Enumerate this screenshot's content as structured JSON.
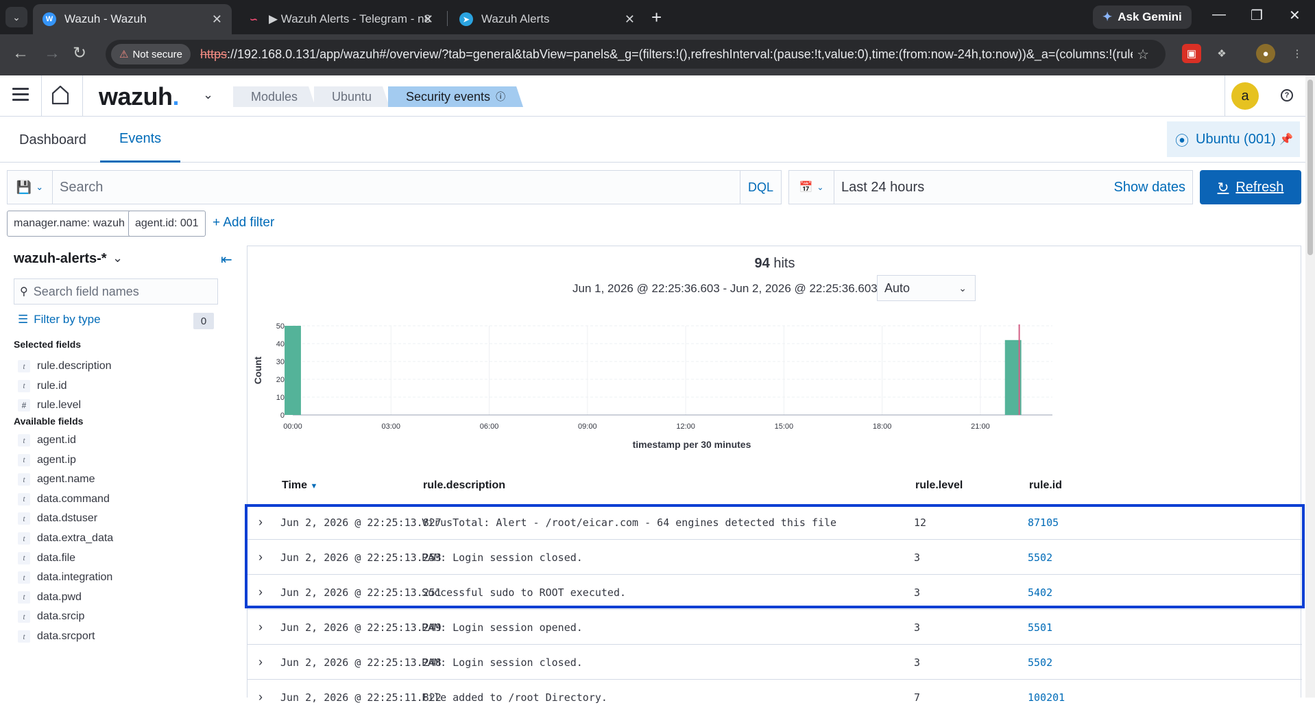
{
  "browser": {
    "tabs": [
      {
        "title": "Wazuh - Wazuh",
        "icon": "wazuh-favicon"
      },
      {
        "title": "▶ Wazuh Alerts - Telegram - n8",
        "icon": "n8n-favicon"
      },
      {
        "title": "Wazuh Alerts",
        "icon": "telegram-favicon"
      }
    ],
    "ask_gemini": "Ask Gemini",
    "not_secure": "Not secure",
    "url_scheme": "https",
    "url_rest": "://192.168.0.131/app/wazuh#/overview/?tab=general&tabView=panels&_g=(filters:!(),refreshInterval:(pause:!t,value:0),time:(from:now-24h,to:now))&_a=(columns:!(rule.d..."
  },
  "header": {
    "logo": "wazuh",
    "breadcrumbs": [
      "Modules",
      "Ubuntu",
      "Security events"
    ],
    "avatar": "a"
  },
  "page_tabs": [
    "Dashboard",
    "Events"
  ],
  "agent_pill": "Ubuntu (001)",
  "search": {
    "placeholder": "Search",
    "dql": "DQL",
    "date_range": "Last 24 hours",
    "show_dates": "Show dates",
    "refresh": "Refresh"
  },
  "filters": [
    "manager.name: wazuh",
    "agent.id: 001"
  ],
  "add_filter": "+ Add filter",
  "sidebar": {
    "index_pattern": "wazuh-alerts-*",
    "field_search_placeholder": "Search field names",
    "filter_by_type": "Filter by type",
    "filter_count": "0",
    "selected_title": "Selected fields",
    "selected": [
      {
        "type": "t",
        "name": "rule.description"
      },
      {
        "type": "t",
        "name": "rule.id"
      },
      {
        "type": "#",
        "name": "rule.level"
      }
    ],
    "available_title": "Available fields",
    "available": [
      {
        "type": "t",
        "name": "agent.id"
      },
      {
        "type": "t",
        "name": "agent.ip"
      },
      {
        "type": "t",
        "name": "agent.name"
      },
      {
        "type": "t",
        "name": "data.command"
      },
      {
        "type": "t",
        "name": "data.dstuser"
      },
      {
        "type": "t",
        "name": "data.extra_data"
      },
      {
        "type": "t",
        "name": "data.file"
      },
      {
        "type": "t",
        "name": "data.integration"
      },
      {
        "type": "t",
        "name": "data.pwd"
      },
      {
        "type": "t",
        "name": "data.srcip"
      },
      {
        "type": "t",
        "name": "data.srcport"
      }
    ]
  },
  "results": {
    "hits_count": "94",
    "hits_label": "hits",
    "time_range": "Jun 1, 2026 @ 22:25:36.603 - Jun 2, 2026 @ 22:25:36.603",
    "interval": "Auto"
  },
  "chart_data": {
    "type": "bar",
    "ylabel": "Count",
    "xlabel": "timestamp per 30 minutes",
    "ylim": [
      0,
      50
    ],
    "yticks": [
      0,
      10,
      20,
      30,
      40,
      50
    ],
    "xticks": [
      "00:00",
      "03:00",
      "06:00",
      "09:00",
      "12:00",
      "15:00",
      "18:00",
      "21:00"
    ],
    "bars": [
      {
        "x_hours": 0.0,
        "value": 50
      },
      {
        "x_hours": 22.0,
        "value": 42
      }
    ],
    "bar_color": "#54b399",
    "now_marker_color": "#d36086"
  },
  "table": {
    "columns": [
      "Time",
      "rule.description",
      "rule.level",
      "rule.id"
    ],
    "rows": [
      {
        "time": "Jun 2, 2026 @ 22:25:13.827",
        "description": "VirusTotal: Alert - /root/eicar.com - 64 engines detected this file",
        "level": "12",
        "id": "87105"
      },
      {
        "time": "Jun 2, 2026 @ 22:25:13.253",
        "description": "PAM: Login session closed.",
        "level": "3",
        "id": "5502"
      },
      {
        "time": "Jun 2, 2026 @ 22:25:13.251",
        "description": "Successful sudo to ROOT executed.",
        "level": "3",
        "id": "5402"
      },
      {
        "time": "Jun 2, 2026 @ 22:25:13.249",
        "description": "PAM: Login session opened.",
        "level": "3",
        "id": "5501"
      },
      {
        "time": "Jun 2, 2026 @ 22:25:13.248",
        "description": "PAM: Login session closed.",
        "level": "3",
        "id": "5502"
      },
      {
        "time": "Jun 2, 2026 @ 22:25:11.822",
        "description": "File added to /root Directory.",
        "level": "7",
        "id": "100201"
      }
    ]
  },
  "colors": {
    "accent": "#006bb8",
    "refresh_button": "#0b64b6",
    "highlight_box": "#0a3fd3"
  }
}
